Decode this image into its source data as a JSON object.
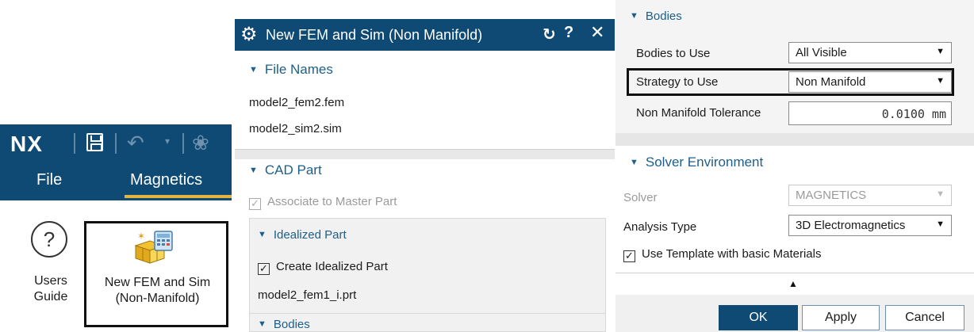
{
  "nx_ribbon": {
    "logo": "NX",
    "tabs": [
      "File",
      "Magnetics"
    ],
    "users_guide_label": "Users\nGuide",
    "users_guide_icon": "question-circle-icon",
    "new_fem_label": "New FEM and Sim\n(Non-Manifold)",
    "new_fem_icon": "fem-sim-icon"
  },
  "dialog": {
    "title": "New FEM and Sim (Non Manifold)",
    "file_names": {
      "header": "File Names",
      "fem_file": "model2_fem2.fem",
      "sim_file": "model2_sim2.sim"
    },
    "cad_part": {
      "header": "CAD Part",
      "associate_label": "Associate to Master Part",
      "associate_checked": true,
      "idealized_header": "Idealized Part",
      "create_idealized_label": "Create Idealized Part",
      "create_idealized_checked": true,
      "idealized_file": "model2_fem1_i.prt",
      "bodies_header": "Bodies"
    }
  },
  "right_panel": {
    "bodies": {
      "header": "Bodies",
      "bodies_to_use_label": "Bodies to Use",
      "bodies_to_use_value": "All Visible",
      "strategy_label": "Strategy to Use",
      "strategy_value": "Non Manifold",
      "tolerance_label": "Non Manifold Tolerance",
      "tolerance_value": "0.0100 mm"
    },
    "solver_environment": {
      "header": "Solver Environment",
      "solver_label": "Solver",
      "solver_value": "MAGNETICS",
      "analysis_type_label": "Analysis Type",
      "analysis_type_value": "3D Electromagnetics",
      "use_template_label": "Use Template with basic Materials",
      "use_template_checked": true
    },
    "buttons": {
      "ok": "OK",
      "apply": "Apply",
      "cancel": "Cancel"
    }
  },
  "colors": {
    "title_bar": "#0e4a73",
    "group_header": "#1c5f8a",
    "tab_underline": "#e0b53f"
  }
}
